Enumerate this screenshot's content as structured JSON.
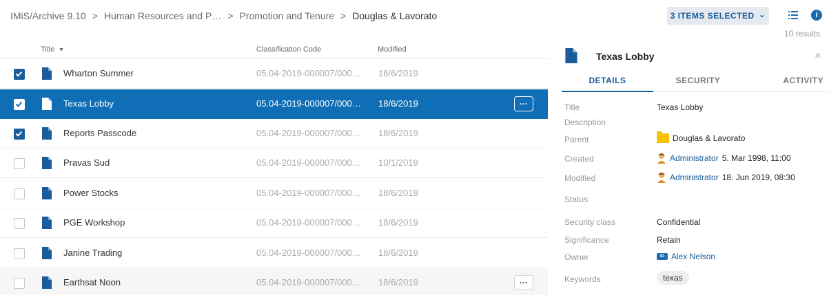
{
  "breadcrumb": {
    "items": [
      "IMiS/Archive 9.10",
      "Human Resources and P…",
      "Promotion and Tenure"
    ],
    "current": "Douglas & Lavorato",
    "separator": ">"
  },
  "toolbar": {
    "selection_label": "3 ITEMS SELECTED",
    "selection_caret": "⌄",
    "info_glyph": "i",
    "results_label": "10 results"
  },
  "table": {
    "columns": {
      "title": "Title",
      "title_sort": "▾",
      "code": "Classification Code",
      "modified": "Modified"
    },
    "more_label": "···",
    "rows": [
      {
        "title": "Wharton Summer",
        "code": "05.04-2019-000007/000…",
        "modified": "18/6/2019",
        "checked": true
      },
      {
        "title": "Texas Lobby",
        "code": "05.04-2019-000007/000…",
        "modified": "18/6/2019",
        "checked": true
      },
      {
        "title": "Reports Passcode",
        "code": "05.04-2019-000007/000…",
        "modified": "18/6/2019",
        "checked": true
      },
      {
        "title": "Pravas Sud",
        "code": "05.04-2019-000007/000…",
        "modified": "10/1/2019",
        "checked": false
      },
      {
        "title": "Power Stocks",
        "code": "05.04-2019-000007/000…",
        "modified": "18/6/2019",
        "checked": false
      },
      {
        "title": "PGE Workshop",
        "code": "05.04-2019-000007/000…",
        "modified": "18/6/2019",
        "checked": false
      },
      {
        "title": "Janine Trading",
        "code": "05.04-2019-000007/000…",
        "modified": "18/6/2019",
        "checked": false
      },
      {
        "title": "Earthsat Noon",
        "code": "05.04-2019-000007/000…",
        "modified": "18/6/2019",
        "checked": false
      }
    ]
  },
  "panel": {
    "title": "Texas Lobby",
    "close": "×",
    "tabs": [
      "DETAILS",
      "SECURITY",
      "ACTIVITY"
    ],
    "fields": {
      "title_label": "Title",
      "title_value": "Texas Lobby",
      "description_label": "Description",
      "parent_label": "Parent",
      "parent_value": "Douglas & Lavorato",
      "created_label": "Created",
      "created_user": "Administrator",
      "created_date": "5. Mar 1998, 11:00",
      "modified_label": "Modified",
      "modified_user": "Administrator",
      "modified_date": "18. Jun 2019, 08:30",
      "status_label": "Status",
      "security_label": "Security class",
      "security_value": "Confidential",
      "significance_label": "Significance",
      "significance_value": "Retain",
      "owner_label": "Owner",
      "owner_value": "Alex Nelson",
      "keywords_label": "Keywords",
      "keyword": "texas"
    }
  },
  "colors": {
    "accent": "#1a5d9a",
    "selected_row": "#0f6eb5",
    "folder": "#f8c300"
  }
}
